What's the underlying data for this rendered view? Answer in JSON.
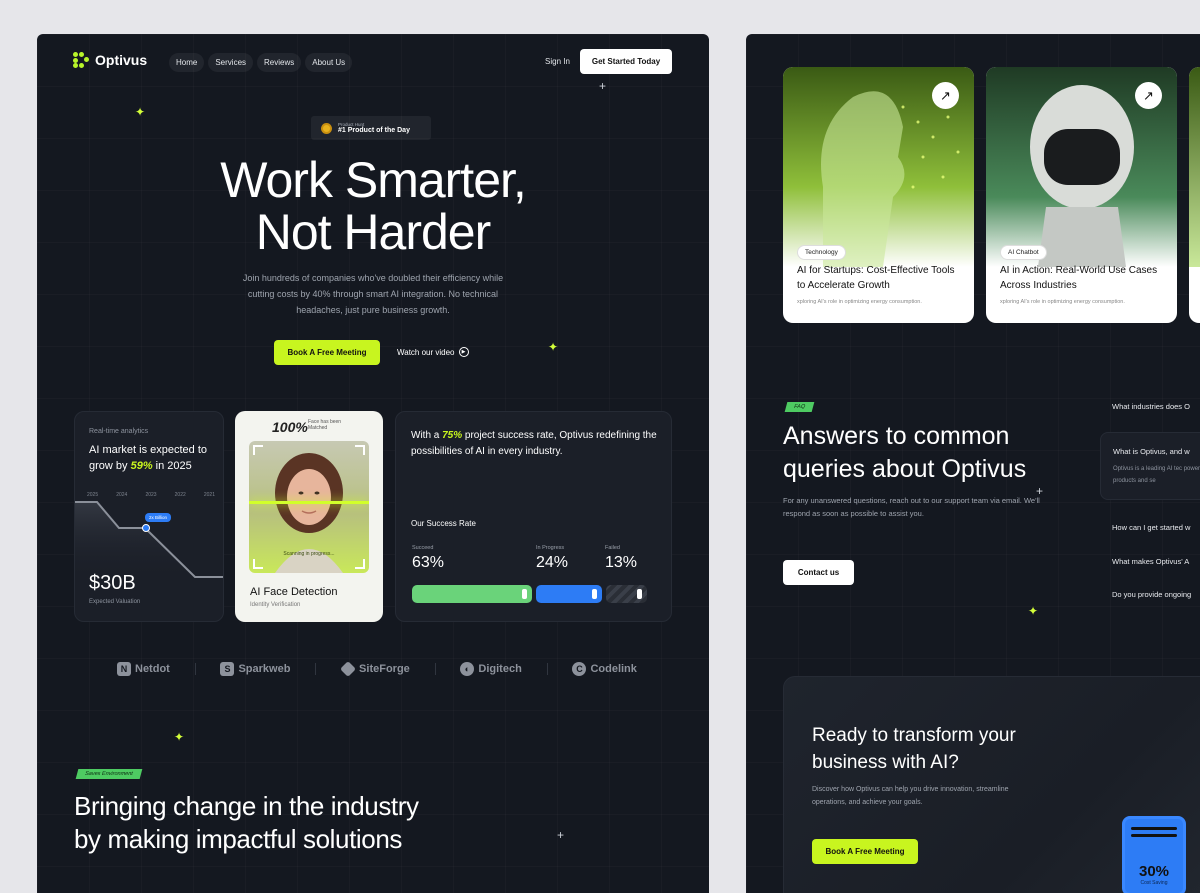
{
  "nav": {
    "brand": "Optivus",
    "items": [
      "Home",
      "Services",
      "Reviews",
      "About Us"
    ],
    "sign_in": "Sign In",
    "cta": "Get Started Today"
  },
  "hero": {
    "badge_small": "Product Hunt",
    "badge_big": "#1 Product of the Day",
    "title_line1": "Work Smarter,",
    "title_line2": "Not Harder",
    "subtitle": "Join hundreds of companies who've doubled their efficiency while cutting costs by 40% through smart AI integration. No technical headaches, just pure business growth.",
    "book_btn": "Book A Free Meeting",
    "watch_btn": "Watch our video"
  },
  "analytics_card": {
    "kicker": "Real-time analytics",
    "title_pre": "AI market is expected to grow by ",
    "title_pct": "59%",
    "title_post": " in 2025",
    "years": [
      "2025",
      "2024",
      "2023",
      "2022",
      "2021"
    ],
    "tooltip": "2x Billion",
    "value": "$30B",
    "value_label": "Expected Valuation"
  },
  "face_card": {
    "score": "100%",
    "score_label": "Face has been Matched",
    "scanning": "Scanning in progress...",
    "title": "AI Face Detection",
    "subtitle": "Identity Verification"
  },
  "success_card": {
    "text_pre": "With a ",
    "text_pct": "75%",
    "text_post": " project success rate, Optivus redefining the possibilities of AI in every industry.",
    "heading": "Our Success Rate",
    "stats": [
      {
        "label": "Succeed",
        "value": "63%",
        "fraction": 0.63,
        "color": "#6ad37a"
      },
      {
        "label": "In Progress",
        "value": "24%",
        "fraction": 0.24,
        "color": "#2d7cf5"
      },
      {
        "label": "Failed",
        "value": "13%",
        "fraction": 0.13,
        "color": "#3a3f49"
      }
    ]
  },
  "logos": [
    "Netdot",
    "Sparkweb",
    "SiteForge",
    "Digitech",
    "Codelink"
  ],
  "impact": {
    "tag": "Saves Environment",
    "heading_line1": "Bringing change in the industry",
    "heading_line2": "by making impactful solutions"
  },
  "blogs": [
    {
      "tag": "Technology",
      "title": "AI for Startups: Cost-Effective Tools to Accelerate Growth",
      "excerpt": "xploring AI's role in optimizing energy consumption."
    },
    {
      "tag": "AI Chatbot",
      "title": "AI in Action: Real-World Use Cases Across Industries",
      "excerpt": "xploring AI's role in optimizing energy consumption."
    }
  ],
  "faq": {
    "tag": "FAQ",
    "heading_line1": "Answers to common",
    "heading_line2": "queries about Optivus",
    "subtitle": "For any unanswered questions, reach out to our support team via email. We'll respond as soon as possible to assist you.",
    "contact": "Contact us",
    "questions": [
      "What industries does O",
      "What is Optivus, and w",
      "How can I get started w",
      "What makes Optivus' A",
      "Do you provide ongoing"
    ],
    "open_answer": "Optivus is a leading AI tec powered products and se"
  },
  "cta": {
    "heading_line1": "Ready to transform your",
    "heading_line2": "business with AI?",
    "subtitle": "Discover how Optivus can help you drive innovation, streamline operations, and achieve your goals.",
    "button": "Book A Free Meeting",
    "save_value": "30%",
    "save_label": "Cost Saving"
  },
  "colors": {
    "accent": "#c8f51f",
    "blue": "#2d7cf5",
    "green": "#4ecb62",
    "bg": "#141820"
  }
}
